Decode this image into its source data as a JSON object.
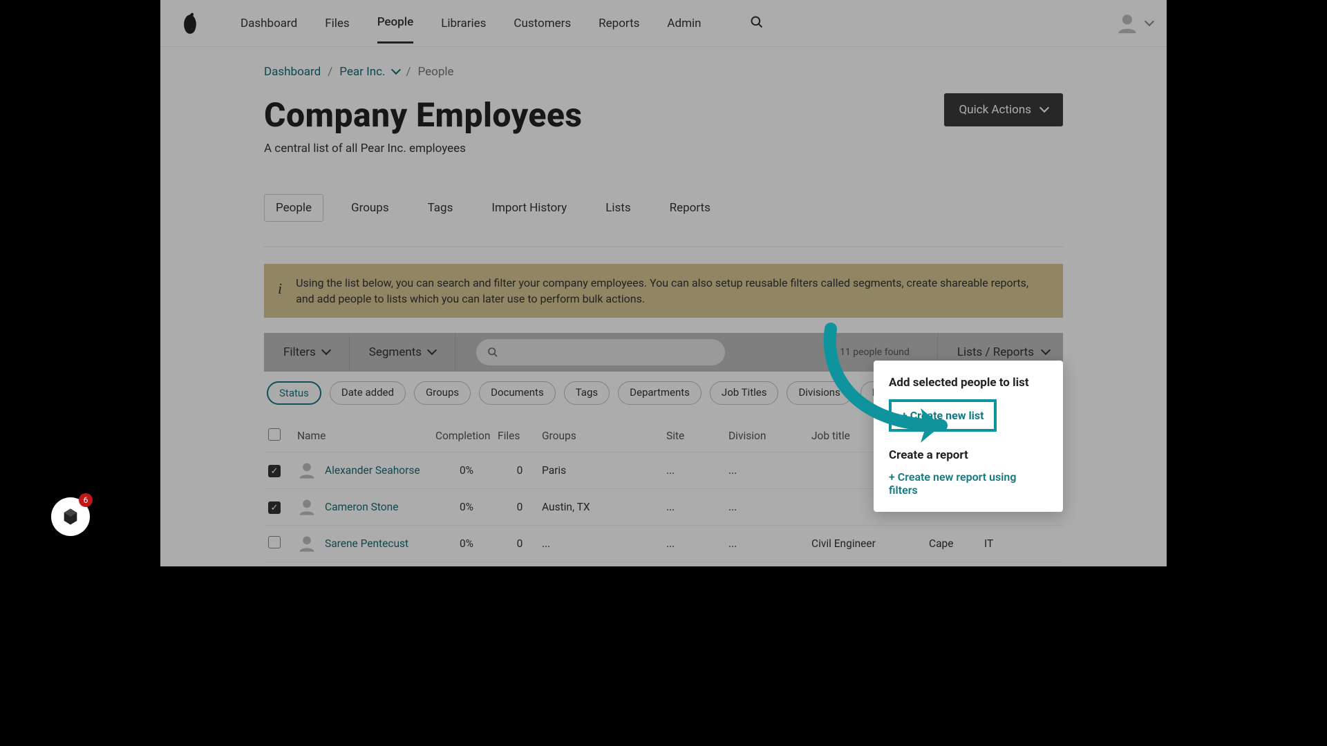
{
  "nav": {
    "items": [
      "Dashboard",
      "Files",
      "People",
      "Libraries",
      "Customers",
      "Reports",
      "Admin"
    ],
    "active_index": 2
  },
  "breadcrumb": {
    "root": "Dashboard",
    "company": "Pear Inc.",
    "current": "People"
  },
  "header": {
    "title": "Company Employees",
    "subtitle": "A central list of all Pear Inc. employees",
    "quick_actions": "Quick Actions"
  },
  "tabs": {
    "items": [
      "People",
      "Groups",
      "Tags",
      "Import History",
      "Lists",
      "Reports"
    ],
    "active_index": 0
  },
  "info_banner": "Using the list below, you can search and filter your company employees. You can also setup reusable filters called segments, create shareable reports, and add people to lists which you can later use to perform bulk actions.",
  "toolbar": {
    "filters": "Filters",
    "segments": "Segments",
    "people_found": "11 people found",
    "lists_reports": "Lists / Reports"
  },
  "filter_chips": [
    "Status",
    "Date added",
    "Groups",
    "Documents",
    "Tags",
    "Departments",
    "Job Titles",
    "Divisions",
    "Man..."
  ],
  "table": {
    "columns": [
      "",
      "Name",
      "Completion",
      "Files",
      "Groups",
      "Site",
      "Division",
      "Job title",
      "",
      ""
    ],
    "rows": [
      {
        "checked": true,
        "name": "Alexander Seahorse",
        "completion": "0%",
        "files": "0",
        "groups": "Paris",
        "site": "...",
        "division": "...",
        "job_title": "",
        "col8": "",
        "col9": ""
      },
      {
        "checked": true,
        "name": "Cameron Stone",
        "completion": "0%",
        "files": "0",
        "groups": "Austin, TX",
        "site": "...",
        "division": "...",
        "job_title": "",
        "col8": "...",
        "col9": "..."
      },
      {
        "checked": false,
        "name": "Sarene Pentecust",
        "completion": "0%",
        "files": "0",
        "groups": "...",
        "site": "...",
        "division": "...",
        "job_title": "Civil Engineer",
        "col8": "Cape",
        "col9": "IT"
      }
    ]
  },
  "dropdown": {
    "title1": "Add selected people to list",
    "create_list": "+ Create new list",
    "title2": "Create a report",
    "create_report": "+ Create new report using filters"
  },
  "widget": {
    "badge": "6"
  }
}
